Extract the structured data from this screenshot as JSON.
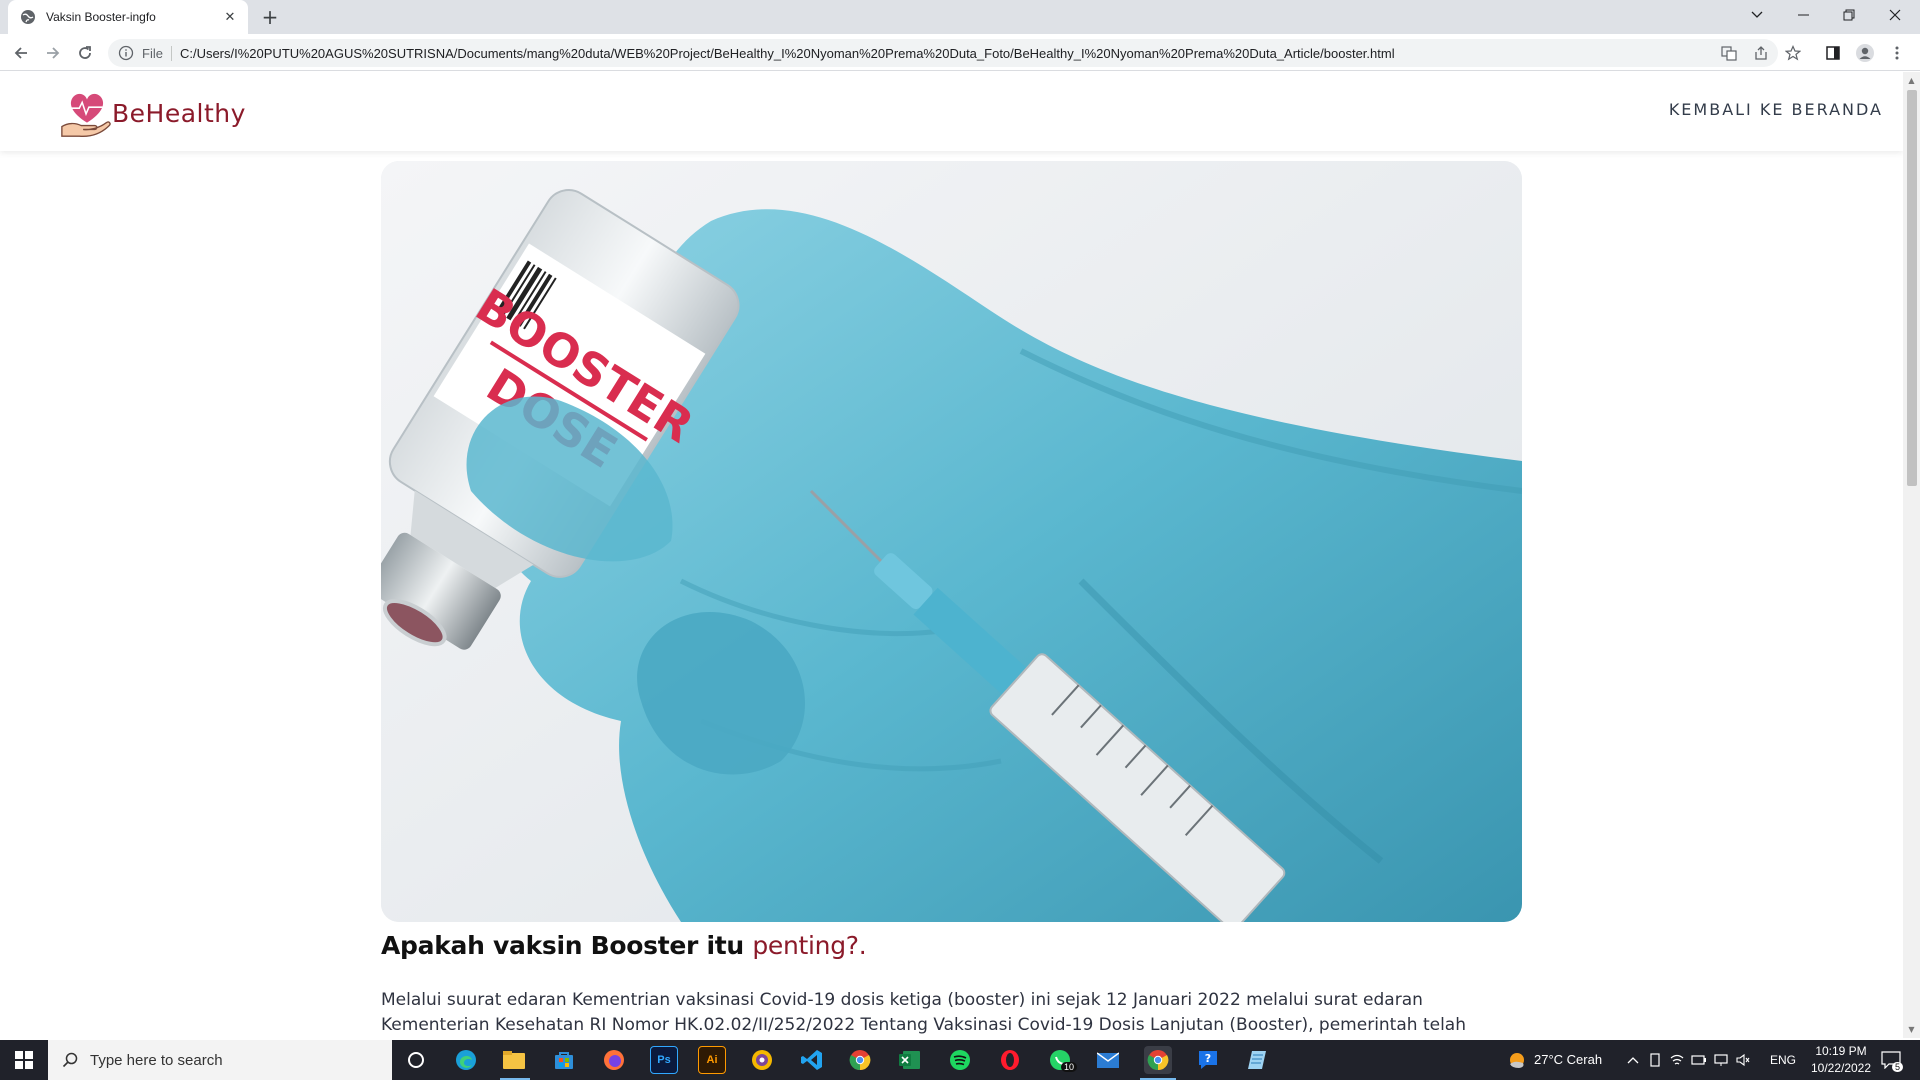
{
  "browser": {
    "tab_title": "Vaksin Booster-ingfo",
    "url_scheme": "File",
    "url": "C:/Users/I%20PUTU%20AGUS%20SUTRISNA/Documents/mang%20duta/WEB%20Project/BeHealthy_I%20Nyoman%20Prema%20Duta_Foto/BeHealthy_I%20Nyoman%20Prema%20Duta_Article/booster.html"
  },
  "site": {
    "logo_text": "BeHealthy",
    "nav_link": "KEMBALI KE BERANDA",
    "brand_color": "#8b1a2a"
  },
  "hero": {
    "label_line1": "BOOSTER",
    "label_line2": "DOSE"
  },
  "article": {
    "title_prefix": "Apakah vaksin Booster itu ",
    "title_accent": "penting?.",
    "body": "Melalui suurat edaran Kementrian vaksinasi Covid-19 dosis ketiga (booster) ini sejak 12 Januari 2022 melalui surat edaran Kementerian Kesehatan RI Nomor HK.02.02/II/252/2022 Tentang Vaksinasi Covid-19 Dosis Lanjutan (Booster), pemerintah telah memulai program vaksinasi"
  },
  "taskbar": {
    "search_placeholder": "Type here to search",
    "weather": "27°C  Cerah",
    "language": "ENG",
    "time": "10:19 PM",
    "date": "10/22/2022",
    "whatsapp_badge": "10",
    "notification_count": "5",
    "apps": [
      "cortana-icon",
      "edge-icon",
      "file-explorer-icon",
      "store-icon",
      "firefox-icon",
      "photoshop-icon",
      "illustrator-icon",
      "tor-icon",
      "vscode-icon",
      "chrome-icon",
      "excel-icon",
      "spotify-icon",
      "opera-icon",
      "whatsapp-icon",
      "mail-icon",
      "chrome-active-icon",
      "help-icon",
      "notepad-icon"
    ]
  }
}
